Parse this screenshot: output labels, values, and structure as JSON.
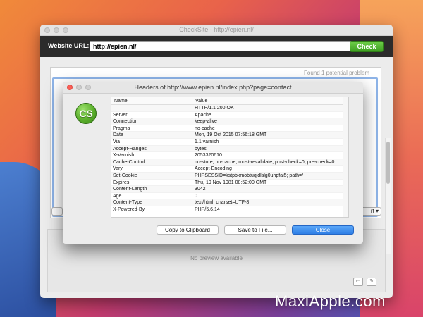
{
  "window": {
    "title": "CheckSite - http://epien.nl/"
  },
  "toolbar": {
    "url_label": "Website URL:",
    "url_value": "http://epien.nl/",
    "check_label": "Check"
  },
  "results": {
    "found_message": "Found 1 potential problem",
    "export_label": "rt"
  },
  "preview": {
    "no_preview_text": "No preview available"
  },
  "dialog": {
    "title": "Headers of http://www.epien.nl/index.php?page=contact",
    "logo_text": "CS",
    "columns": {
      "name": "Name",
      "value": "Value"
    },
    "rows": [
      {
        "name": "",
        "value": "HTTP/1.1 200 OK"
      },
      {
        "name": "Server",
        "value": "Apache"
      },
      {
        "name": "Connection",
        "value": "keep-alive"
      },
      {
        "name": "Pragma",
        "value": "no-cache"
      },
      {
        "name": "Date",
        "value": "Mon, 19 Oct 2015 07:56:18 GMT"
      },
      {
        "name": "Via",
        "value": "1.1 varnish"
      },
      {
        "name": "Accept-Ranges",
        "value": "bytes"
      },
      {
        "name": "X-Varnish",
        "value": "2053320610"
      },
      {
        "name": "Cache-Control",
        "value": "no-store, no-cache, must-revalidate, post-check=0, pre-check=0"
      },
      {
        "name": "Vary",
        "value": "Accept-Encoding"
      },
      {
        "name": "Set-Cookie",
        "value": "PHPSESSID=kstpbkmobtuqjdlslg0uhpfai5; path=/"
      },
      {
        "name": "Expires",
        "value": "Thu, 19 Nov 1981 08:52:00 GMT"
      },
      {
        "name": "Content-Length",
        "value": "3042"
      },
      {
        "name": "Age",
        "value": "0"
      },
      {
        "name": "Content-Type",
        "value": "text/html; charset=UTF-8"
      },
      {
        "name": "X-Powered-By",
        "value": "PHP/5.6.14"
      }
    ],
    "buttons": {
      "copy": "Copy to Clipboard",
      "save": "Save to File...",
      "close": "Close"
    }
  },
  "icons": {
    "gear": "gear-icon",
    "dropdown": "chevron-down-icon"
  },
  "colors": {
    "check_button": "#4caf2c",
    "close_button": "#2f7fe6",
    "toolbar_bg": "#2b2b2b"
  },
  "watermark": "MaxiApple.com"
}
